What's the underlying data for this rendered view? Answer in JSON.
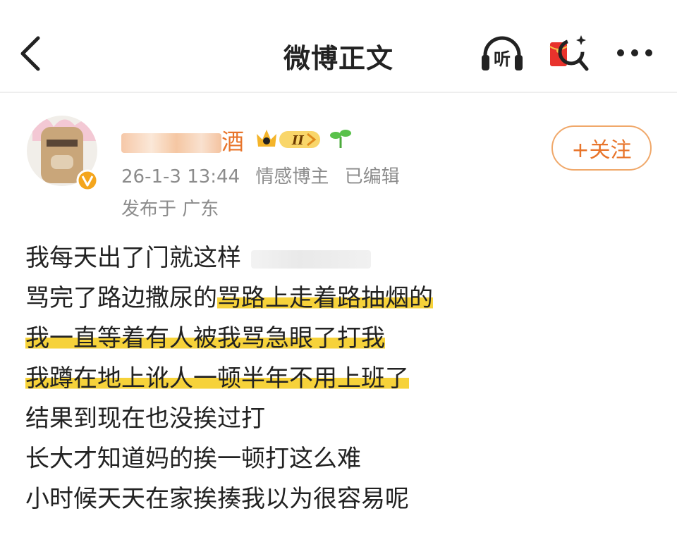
{
  "header": {
    "title": "微博正文",
    "listen_label": "听"
  },
  "post": {
    "author_name": "酒",
    "level_badge": "II",
    "timestamp": "26-1-3 13:44",
    "author_tag": "情感博主",
    "edited_label": "已编辑",
    "location": "发布于 广东",
    "follow_label": "+关注",
    "lines": [
      "我每天出了门就这样",
      "骂完了路边撒尿的",
      "骂路上走着路抽烟的",
      "我一直等着有人被我骂急眼了打我",
      "我蹲在地上讹人一顿半年不用上班了",
      "结果到现在也没挨过打",
      "长大才知道妈的挨一顿打这么难",
      "小时候天天在家挨揍我以为很容易呢"
    ]
  },
  "colors": {
    "accent_orange": "#e8742a",
    "highlight_yellow": "#f6d23a",
    "meta_gray": "#8c8c8c"
  }
}
